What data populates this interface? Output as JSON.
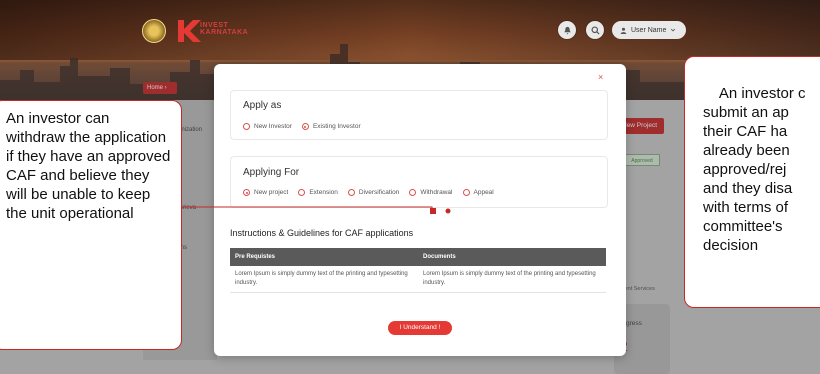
{
  "header": {
    "brand_line1": "INVEST",
    "brand_line2": "KARNATAKA",
    "user_label": "User Name"
  },
  "breadcrumb": "Home",
  "sidebar": {
    "items": [
      {
        "label": "Organization"
      },
      {
        "label": "rds"
      },
      {
        "label": "y & Grieva"
      },
      {
        "label": "cations"
      }
    ]
  },
  "page": {
    "new_project_label": "New Project",
    "approved_badge": "Approved",
    "services_label": "ment Services",
    "progress_label": "gress",
    "progress_value": "2"
  },
  "modal": {
    "close_symbol": "×",
    "apply_as": {
      "title": "Apply as",
      "options": [
        "New Investor",
        "Existing Investor"
      ],
      "selected": "Existing Investor"
    },
    "applying_for": {
      "title": "Applying For",
      "options": [
        "New project",
        "Extension",
        "Diversification",
        "Withdrawal",
        "Appeal"
      ],
      "selected": "New project"
    },
    "instructions_title": "Instructions & Guidelines for CAF applications",
    "table": {
      "headers": [
        "Pre Requistes",
        "Documents"
      ],
      "rows": [
        [
          "Lorem Ipsum is simply dummy text of the printing and typesetting industry.",
          "Lorem Ipsum is simply dummy text of the printing and typesetting industry."
        ]
      ]
    },
    "understand_label": "I Understand !"
  },
  "callouts": {
    "left": "An investor can withdraw the application if they have an approved CAF and believe they will be unable to keep the unit operational",
    "right": "An investor c\nsubmit an ap\ntheir CAF ha\nalready been\napproved/rej\nand they disa\nwith terms of\ncommittee's\ndecision"
  },
  "colors": {
    "accent": "#e53935",
    "callout_border": "#c62828",
    "header_bg": "#6e3a22"
  }
}
